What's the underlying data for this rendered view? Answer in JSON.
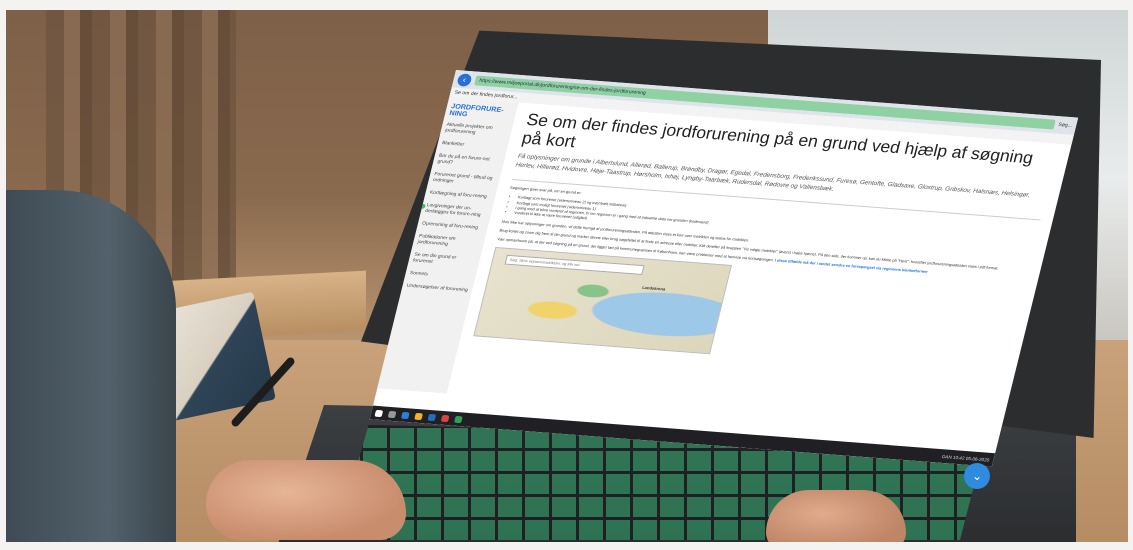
{
  "browser": {
    "back_icon": "arrow-left-icon",
    "url": "https://www.miljoeportal.dk/jordforurening/se-om-der-findes-jordforurening",
    "tab": "Se om der findes jordforur...",
    "search_placeholder": "Søg..."
  },
  "sidebar": {
    "title": "JORDFORURE-NING",
    "items": [
      {
        "label": "Aktuelle projekter om jordforurening",
        "active": false
      },
      {
        "label": "Blanketter",
        "active": false
      },
      {
        "label": "Bor du på en forure-net grund?",
        "active": false
      },
      {
        "label": "Forurenet grund - tilbud og ordninger",
        "active": false
      },
      {
        "label": "Kortlægning af foru-rening",
        "active": false
      },
      {
        "label": "Lovgivninger der un-derlægges for forure-ning",
        "active": true
      },
      {
        "label": "Oprensning af foru-rening",
        "active": false
      },
      {
        "label": "Publikationer om jordforurening",
        "active": false
      },
      {
        "label": "Se om din grund er forurenet",
        "active": false
      },
      {
        "label": "Sonnets",
        "active": false
      },
      {
        "label": "Undersøgelser af forurening",
        "active": false
      }
    ]
  },
  "content": {
    "title": "Se om der findes jordforurening på en grund ved hjælp af søgning på kort",
    "lead": "Få oplysninger om grunde i Albertslund, Allerød, Ballerup, Brøndby, Dragør, Egedal, Fredensborg, Frederikssund, Furesø, Gentofte, Gladsaxe, Glostrup, Gribskov, Halsnæs, Helsingør, Herlev, Hillerød, Hvidovre, Høje-Taastrup, Hørsholm, Ishøj, Lyngby-Taarbæk, Rudersdal, Rødovre og Vallensbæk.",
    "intro": "Søgningen giver svar på, om en grund er:",
    "bullets": [
      "Kortlagt som forurenet (vidensniveau 2) og eventuelt indsatsvej",
      "Kortlagt som muligt forurenet (vidensniveau 1)",
      "I gang med at blive vurderet af regionen, fx om regionen er i gang med at indsamle data om grunden (kodeværd)",
      "Vurderet til ikke at være forurenet (udgået)"
    ],
    "p1": "Hvis ikke har oplysninger om grunden, vil dette fremgå af jordforureningsattesten. På attesten vises et kort over matriklen og status for matriklen.",
    "p2": "Brug kortet og zoom dig frem til din grund og marker denne eller brug søgefeltet til at finde en adresse eller matrikel. Klik derefter på knappen \"Vis valgte matrikler\" (øverst i højre hjørne). På den side, der kommer op, kan du klikke på \"Hent\", hvorefter jordforureningsattesten vises i pdf-format.",
    "p3_start": "Vær opmærksom på, at der ved søgning på en grund, der ligger tæt på kommunegrænsen til København, kan være problemer med at henvise via kortsøgningen.",
    "p3_link": "I disse tilfælde må der i stedet sendes en forespørgsel via regionens blanketformer"
  },
  "map": {
    "search_placeholder": "Søg: Skriv vejnavn/matrikelnr. og klik ind",
    "label": "Landskrona"
  },
  "taskbar": {
    "tray": "DAN  10:42  05-06-2020"
  },
  "fab": {
    "icon": "chevron-double-down-icon",
    "glyph": "⌄"
  }
}
